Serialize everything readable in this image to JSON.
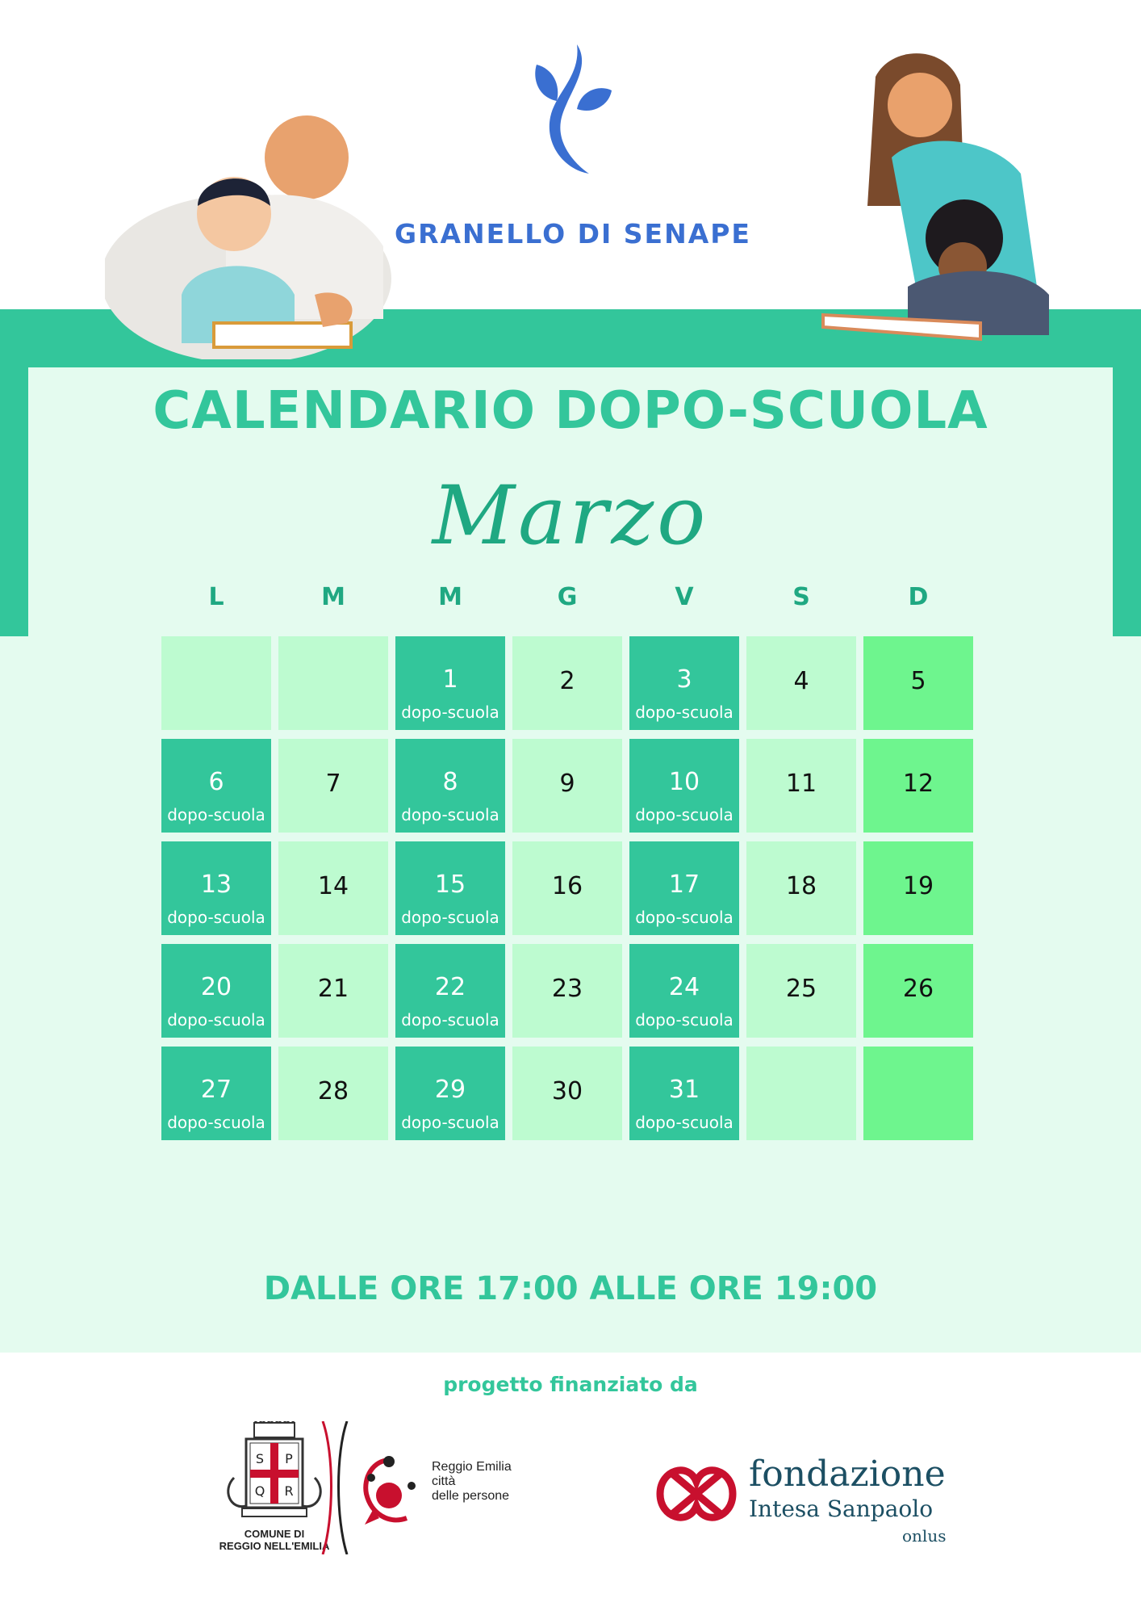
{
  "brand": {
    "name": "GRANELLO DI SENAPE"
  },
  "title": "CALENDARIO DOPO-SCUOLA",
  "month": "Marzo",
  "weekdays": [
    "L",
    "M",
    "M",
    "G",
    "V",
    "S",
    "D"
  ],
  "calendar": {
    "event_label": "dopo-scuola",
    "weeks": [
      [
        {
          "day": "",
          "event": false
        },
        {
          "day": "",
          "event": false
        },
        {
          "day": "1",
          "event": true
        },
        {
          "day": "2",
          "event": false
        },
        {
          "day": "3",
          "event": true
        },
        {
          "day": "4",
          "event": false
        },
        {
          "day": "5",
          "event": false
        }
      ],
      [
        {
          "day": "6",
          "event": true
        },
        {
          "day": "7",
          "event": false
        },
        {
          "day": "8",
          "event": true
        },
        {
          "day": "9",
          "event": false
        },
        {
          "day": "10",
          "event": true
        },
        {
          "day": "11",
          "event": false
        },
        {
          "day": "12",
          "event": false
        }
      ],
      [
        {
          "day": "13",
          "event": true
        },
        {
          "day": "14",
          "event": false
        },
        {
          "day": "15",
          "event": true
        },
        {
          "day": "16",
          "event": false
        },
        {
          "day": "17",
          "event": true
        },
        {
          "day": "18",
          "event": false
        },
        {
          "day": "19",
          "event": false
        }
      ],
      [
        {
          "day": "20",
          "event": true
        },
        {
          "day": "21",
          "event": false
        },
        {
          "day": "22",
          "event": true
        },
        {
          "day": "23",
          "event": false
        },
        {
          "day": "24",
          "event": true
        },
        {
          "day": "25",
          "event": false
        },
        {
          "day": "26",
          "event": false
        }
      ],
      [
        {
          "day": "27",
          "event": true
        },
        {
          "day": "28",
          "event": false
        },
        {
          "day": "29",
          "event": true
        },
        {
          "day": "30",
          "event": false
        },
        {
          "day": "31",
          "event": true
        },
        {
          "day": "",
          "event": false
        },
        {
          "day": "",
          "event": false
        }
      ]
    ]
  },
  "hours": "DALLE ORE 17:00 ALLE ORE 19:00",
  "funded_by": "progetto finanziato da",
  "sponsors": {
    "comune": {
      "line1": "COMUNE DI",
      "line2": "REGGIO NELL'EMILIA",
      "seal_letters": [
        "S",
        "P",
        "Q",
        "R"
      ]
    },
    "reggio_emilia": {
      "line1": "Reggio Emilia",
      "line2": "città",
      "line3": "delle persone"
    },
    "fondazione": {
      "line1": "fondazione",
      "line2": "Intesa Sanpaolo",
      "line3": "onlus"
    }
  },
  "colors": {
    "accent": "#33c69b",
    "panel": "#e4fbef",
    "event_cell": "#33c69b",
    "plain_cell": "#bdfbd0",
    "sunday_cell": "#6ef58e",
    "brand_blue": "#3a6fd1"
  }
}
